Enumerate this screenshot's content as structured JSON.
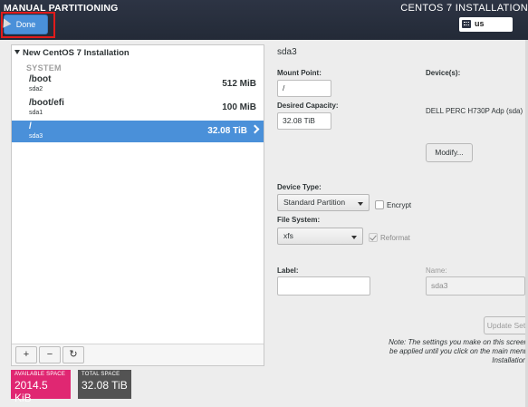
{
  "header": {
    "title": "MANUAL PARTITIONING",
    "product": "CENTOS 7 INSTALLATION",
    "done_label": "Done",
    "keyboard_layout": "us",
    "colors": {
      "header_bg": "#2d3444",
      "done_bg": "#4a90d9",
      "highlight_border": "#e21b1b"
    }
  },
  "tree": {
    "install_label": "New CentOS 7 Installation",
    "system_label": "SYSTEM",
    "partitions": [
      {
        "mount": "/boot",
        "device": "sda2",
        "size": "512 MiB"
      },
      {
        "mount": "/boot/efi",
        "device": "sda1",
        "size": "100 MiB"
      },
      {
        "mount": "/",
        "device": "sda3",
        "size": "32.08 TiB"
      }
    ],
    "selected_index": 2
  },
  "toolbar": {
    "add_label": "+",
    "remove_label": "−",
    "refresh_label": "↻"
  },
  "space": {
    "available_label": "AVAILABLE SPACE",
    "available_value": "2014.5 KiB",
    "total_label": "TOTAL SPACE",
    "total_value": "32.08 TiB",
    "colors": {
      "available": "#e02772",
      "total": "#535353"
    }
  },
  "details": {
    "section_title": "sda3",
    "mount_point_label": "Mount Point:",
    "mount_point_value": "/",
    "desired_capacity_label": "Desired Capacity:",
    "desired_capacity_value": "32.08 TiB",
    "devices_label": "Device(s):",
    "device_name": "DELL PERC H730P Adp (sda)",
    "modify_label": "Modify...",
    "device_type_label": "Device Type:",
    "device_type_value": "Standard Partition",
    "encrypt_label": "Encrypt",
    "file_system_label": "File System:",
    "file_system_value": "xfs",
    "reformat_label": "Reformat",
    "label_label": "Label:",
    "label_value": "",
    "name_label": "Name:",
    "name_value": "sda3",
    "update_label": "Update Set",
    "note_lines": [
      "Note:  The settings you make on this screen",
      "be applied until you click on the main menu",
      "Installation'"
    ]
  }
}
